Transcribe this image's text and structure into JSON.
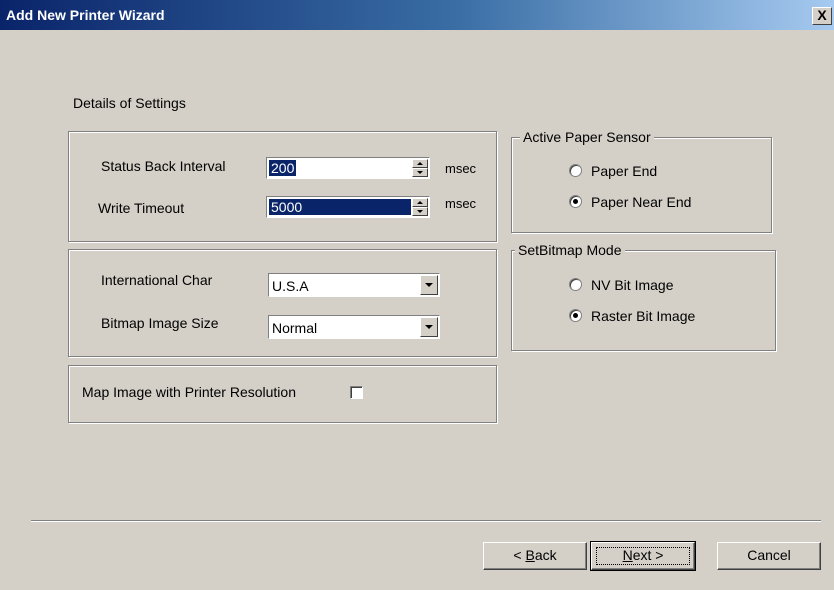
{
  "window": {
    "title": "Add New Printer Wizard",
    "close_glyph": "X"
  },
  "section_title": "Details of Settings",
  "timing": {
    "status_back_interval": {
      "label": "Status Back Interval",
      "value": "200",
      "unit": "msec"
    },
    "write_timeout": {
      "label": "Write Timeout",
      "value": "5000",
      "unit": "msec"
    }
  },
  "charset": {
    "international_char": {
      "label": "International Char",
      "value": "U.S.A"
    },
    "bitmap_image_size": {
      "label": "Bitmap Image Size",
      "value": "Normal"
    }
  },
  "map_image": {
    "label": "Map Image with Printer Resolution",
    "checked": false
  },
  "paper_sensor": {
    "legend": "Active Paper Sensor",
    "options": [
      {
        "label": "Paper End",
        "selected": false
      },
      {
        "label": "Paper Near End",
        "selected": true
      }
    ]
  },
  "bitmap_mode": {
    "legend": "SetBitmap Mode",
    "options": [
      {
        "label": "NV Bit Image",
        "selected": false
      },
      {
        "label": "Raster Bit Image",
        "selected": true
      }
    ]
  },
  "buttons": {
    "back": {
      "mnemonic": "B",
      "rest": "ack",
      "prefix": "< "
    },
    "next": {
      "mnemonic": "N",
      "rest": "ext >"
    },
    "cancel": "Cancel"
  },
  "icons": {
    "close": "close-icon",
    "spin_up": "spin-up-arrow-icon",
    "spin_down": "spin-down-arrow-icon",
    "dropdown": "chevron-down-icon"
  },
  "colors": {
    "face": "#d4d0c8",
    "title_active": "#0a246a",
    "selection": "#0a246a"
  }
}
